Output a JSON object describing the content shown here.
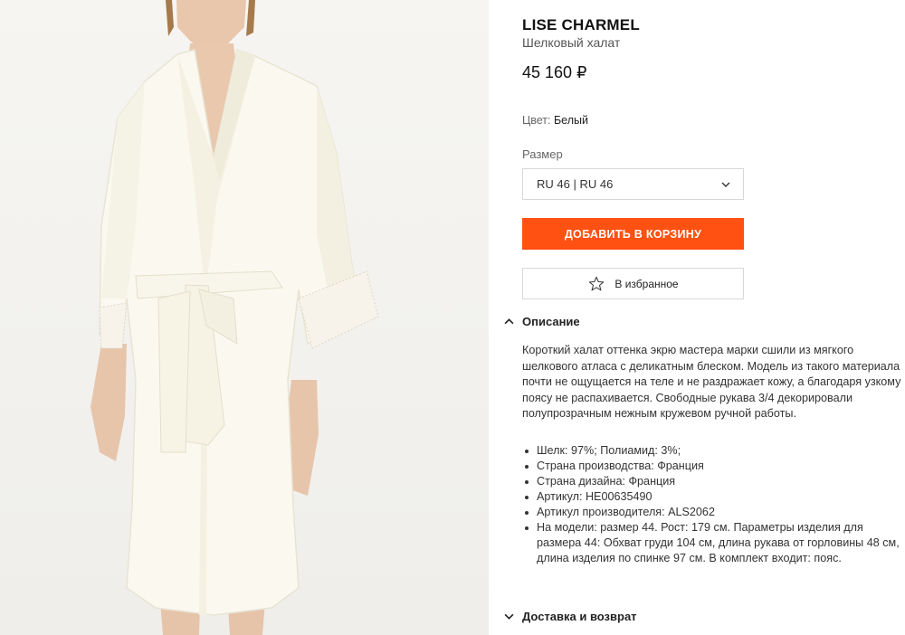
{
  "product": {
    "brand": "LISE CHARMEL",
    "name": "Шелковый халат",
    "price": "45 160 ₽",
    "color_label": "Цвет: ",
    "color_value": "Белый",
    "size_label": "Размер",
    "size_selected": "RU 46 | RU 46",
    "add_to_cart": "ДОБАВИТЬ В КОРЗИНУ",
    "favorite": "В избранное"
  },
  "description": {
    "title": "Описание",
    "text": "Короткий халат оттенка экрю мастера марки сшили из мягкого шелкового атласа с деликатным блеском. Модель из такого материала почти не ощущается на теле и не раздражает кожу, а благодаря узкому поясу не распахивается. Свободные рукава 3/4 декорировали полупрозрачным нежным кружевом ручной работы.",
    "specs": [
      "Шелк: 97%; Полиамид: 3%;",
      "Страна производства: Франция",
      "Страна дизайна: Франция",
      "Артикул: HE00635490",
      "Артикул производителя: ALS2062",
      "На модели: размер 44. Рост: 179 см. Параметры изделия для размера 44: Обхват груди 104 см, длина рукава от горловины 48 см, длина изделия по спинке 97 см. В комплект входит: пояс."
    ]
  },
  "delivery": {
    "title": "Доставка и возврат"
  },
  "icons": {
    "size_dropdown": "chevron-down-icon",
    "favorite": "star-outline-icon",
    "description_toggle": "chevron-up-icon",
    "delivery_toggle": "chevron-down-icon"
  },
  "colors": {
    "accent": "#ff5112",
    "border": "#d8d8d8"
  }
}
